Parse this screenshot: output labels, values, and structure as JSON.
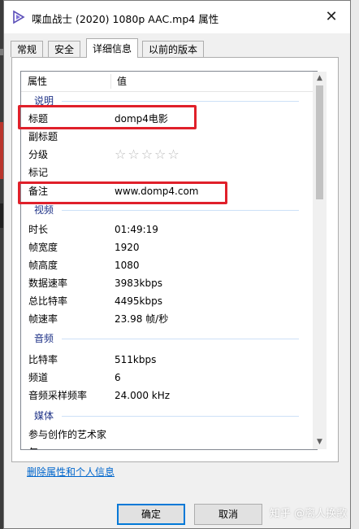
{
  "window": {
    "title": "喋血战士 (2020) 1080p AAC.mp4 属性",
    "close_glyph": "✕"
  },
  "tabs": [
    {
      "label": "常规"
    },
    {
      "label": "安全"
    },
    {
      "label": "详细信息",
      "active": true
    },
    {
      "label": "以前的版本"
    }
  ],
  "list": {
    "headers": {
      "property": "属性",
      "value": "值"
    },
    "groups": {
      "description": "说明",
      "video": "视频",
      "audio": "音频",
      "media": "媒体"
    },
    "description_rows": [
      {
        "key": "标题",
        "value": "domp4电影"
      },
      {
        "key": "副标题",
        "value": ""
      },
      {
        "key": "分级",
        "value": ""
      },
      {
        "key": "标记",
        "value": ""
      },
      {
        "key": "备注",
        "value": "www.domp4.com"
      }
    ],
    "rating_stars": "☆☆☆☆☆",
    "video_rows": [
      {
        "key": "时长",
        "value": "01:49:19"
      },
      {
        "key": "帧宽度",
        "value": "1920"
      },
      {
        "key": "帧高度",
        "value": "1080"
      },
      {
        "key": "数据速率",
        "value": "3983kbps"
      },
      {
        "key": "总比特率",
        "value": "4495kbps"
      },
      {
        "key": "帧速率",
        "value": "23.98 帧/秒"
      }
    ],
    "audio_rows": [
      {
        "key": "比特率",
        "value": "511kbps"
      },
      {
        "key": "频道",
        "value": "6"
      },
      {
        "key": "音频采样频率",
        "value": "24.000 kHz"
      }
    ],
    "media_rows": [
      {
        "key": "参与创作的艺术家",
        "value": ""
      },
      {
        "key": "年",
        "value": ""
      }
    ]
  },
  "remove_link": "删除属性和个人信息",
  "buttons": {
    "ok": "确定",
    "cancel": "取消"
  },
  "watermark": "知乎 @离人换歌",
  "colors": {
    "highlight": "#e0202a",
    "group_label": "#1e3287",
    "link": "#0066cc",
    "accent": "#0078d7"
  }
}
